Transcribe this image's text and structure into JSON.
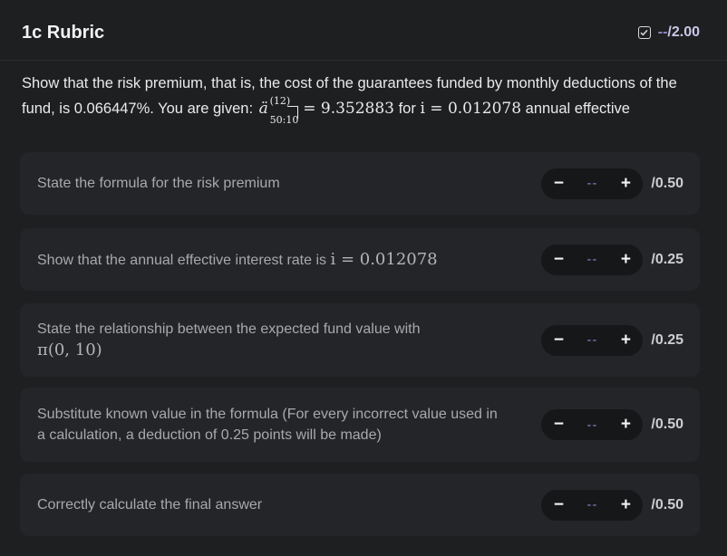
{
  "header": {
    "title": "1c Rubric",
    "score_display": "--",
    "score_max": "/2.00"
  },
  "question": {
    "text_part1": "Show that the risk premium, that is, the cost of the guarantees funded by monthly deductions of the fund, is 0.066447%. You are given:",
    "annuity_symbol": "ä",
    "annuity_superscript": "(12)",
    "annuity_subscript": "50:10",
    "annuity_equals": "= 9.352883",
    "text_part2": "for",
    "rate_expr": "i = 0.012078",
    "text_part3": "annual effective"
  },
  "criteria": [
    {
      "label": "State the formula for the risk premium",
      "math": "",
      "score": "--",
      "max": "/0.50"
    },
    {
      "label": "Show that the annual effective interest rate is",
      "math": "i = 0.012078",
      "score": "--",
      "max": "/0.25"
    },
    {
      "label": "State the relationship between the expected fund value with",
      "math": "π(0, 10)",
      "score": "--",
      "max": "/0.25"
    },
    {
      "label": "Substitute known value in the formula (For every incorrect value used in a calculation, a deduction of 0.25 points will be made)",
      "math": "",
      "score": "--",
      "max": "/0.50"
    },
    {
      "label": "Correctly calculate the final answer",
      "math": "",
      "score": "--",
      "max": "/0.50"
    }
  ],
  "controls": {
    "minus": "−",
    "plus": "+"
  },
  "icons": {
    "total": "checkbox-icon"
  },
  "colors": {
    "background": "#1e1f21",
    "card": "#242528",
    "accent": "#8f8ccc"
  }
}
